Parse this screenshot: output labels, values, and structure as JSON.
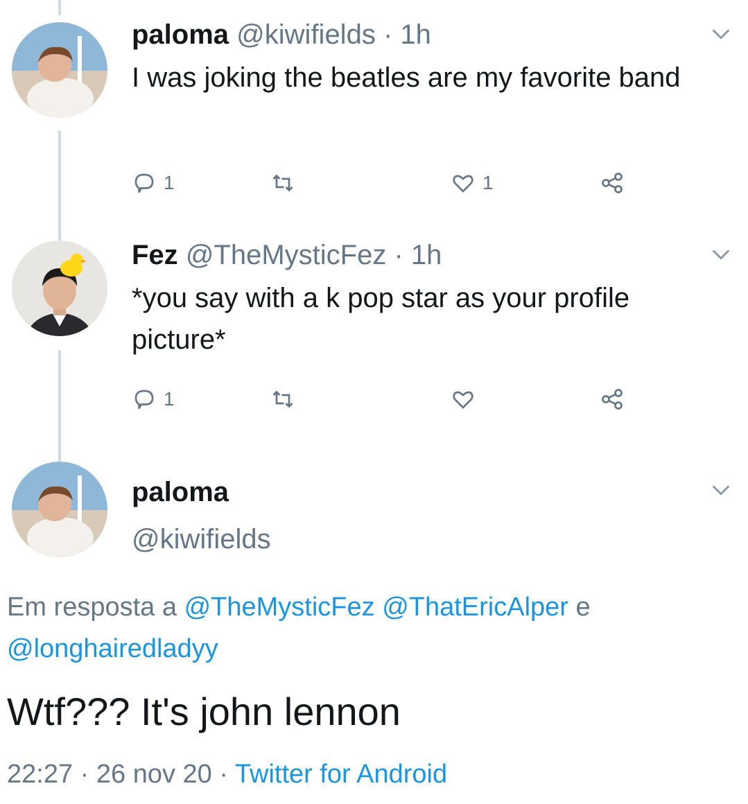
{
  "tweets": [
    {
      "name": "paloma",
      "handle": "@kiwifields",
      "separator": "·",
      "time": "1h",
      "text": "I was joking the beatles are my favorite band",
      "replies": "1",
      "retweets": "",
      "likes": "1"
    },
    {
      "name": "Fez",
      "handle": "@TheMysticFez",
      "separator": "·",
      "time": "1h",
      "text": "*you say with a k pop star as your profile picture*",
      "replies": "1",
      "retweets": "",
      "likes": ""
    }
  ],
  "main_tweet": {
    "name": "paloma",
    "handle": "@kiwifields",
    "reply_prefix": "Em resposta a",
    "reply_to": [
      "@TheMysticFez",
      "@ThatEricAlper"
    ],
    "reply_conjunction": "e",
    "reply_to_last": "@longhairedladyy",
    "text": "Wtf??? It's john lennon",
    "time": "22:27",
    "separator": "·",
    "date": "26 nov 20",
    "source": "Twitter for Android"
  },
  "icons": [
    "reply-icon",
    "retweet-icon",
    "like-icon",
    "share-icon",
    "caret-down-icon"
  ],
  "colors": {
    "link": "#1b95e0",
    "muted": "#657786",
    "text": "#14171a",
    "thread": "#cfd9de"
  }
}
